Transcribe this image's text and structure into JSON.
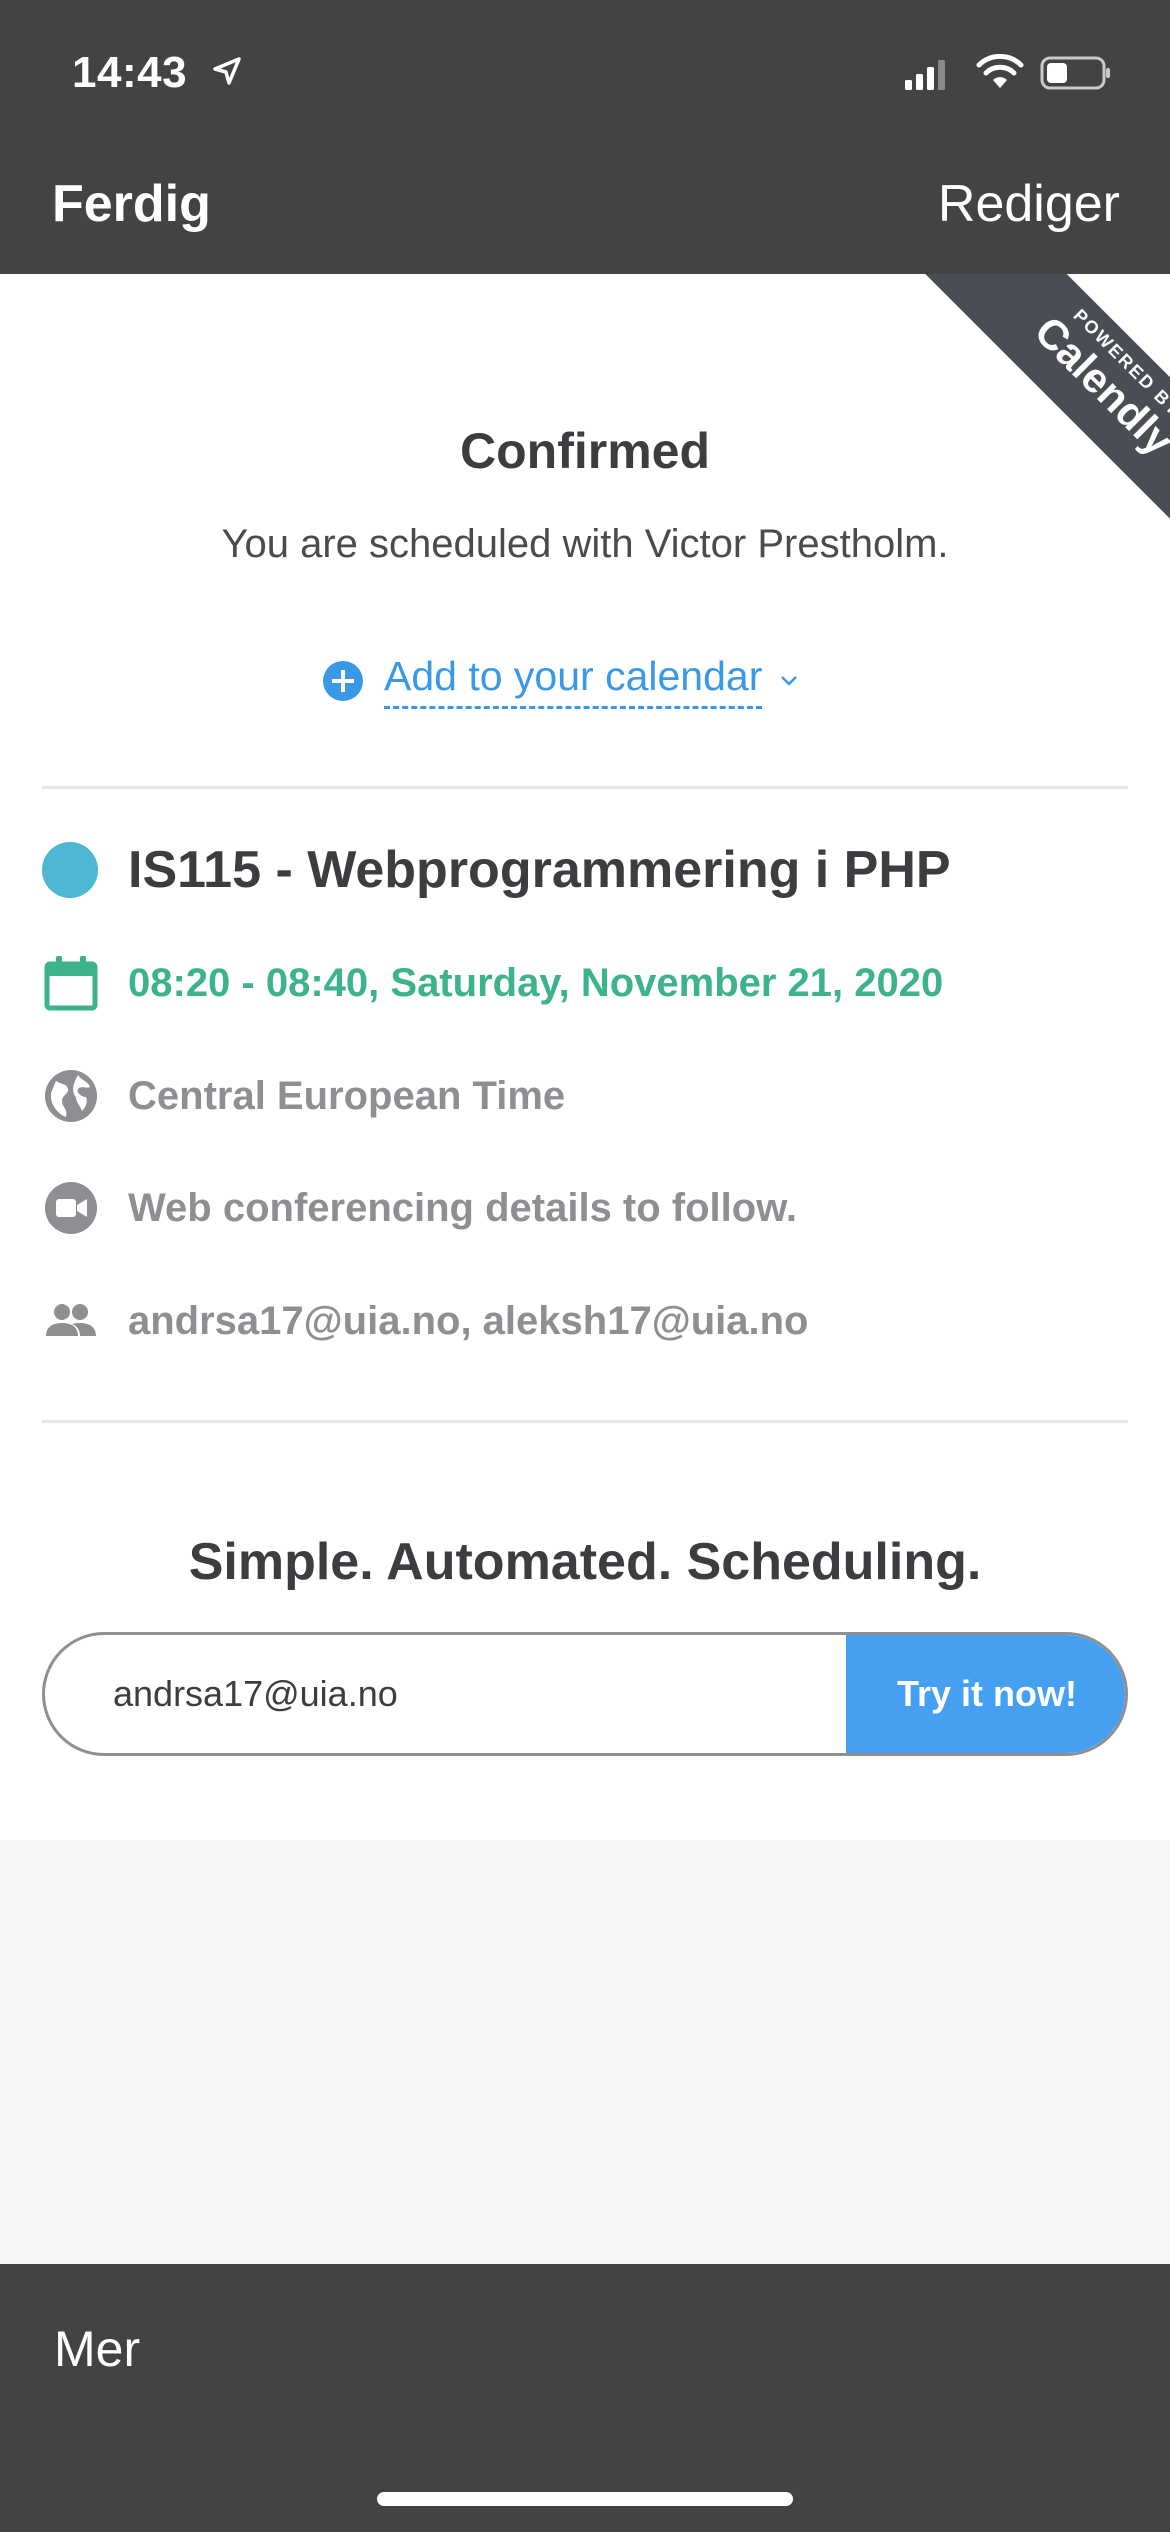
{
  "status_bar": {
    "time": "14:43"
  },
  "nav": {
    "done_label": "Ferdig",
    "edit_label": "Rediger"
  },
  "ribbon": {
    "small": "POWERED BY",
    "brand": "Calendly"
  },
  "confirmation": {
    "title": "Confirmed",
    "subtitle": "You are scheduled with Victor Prestholm.",
    "add_calendar_label": "Add to your calendar"
  },
  "event": {
    "title": "IS115 - Webprogrammering i PHP",
    "dot_color": "#4db7d4",
    "datetime": "08:20 - 08:40, Saturday, November 21, 2020",
    "timezone": "Central European Time",
    "conferencing": "Web conferencing details to follow.",
    "invitees": "andrsa17@uia.no, aleksh17@uia.no"
  },
  "promo": {
    "tagline": "Simple. Automated. Scheduling.",
    "email_value": "andrsa17@uia.no",
    "button_label": "Try it now!"
  },
  "toolbar": {
    "more_label": "Mer"
  },
  "colors": {
    "chrome": "#434345",
    "link_blue": "#3a99e6",
    "green": "#3cb38a",
    "button_blue": "#45a0f2"
  },
  "icons": [
    "location-arrow-icon",
    "signal-icon",
    "wifi-icon",
    "battery-icon",
    "plus-circle-icon",
    "chevron-down-icon",
    "calendar-icon",
    "globe-icon",
    "video-icon",
    "people-icon"
  ]
}
